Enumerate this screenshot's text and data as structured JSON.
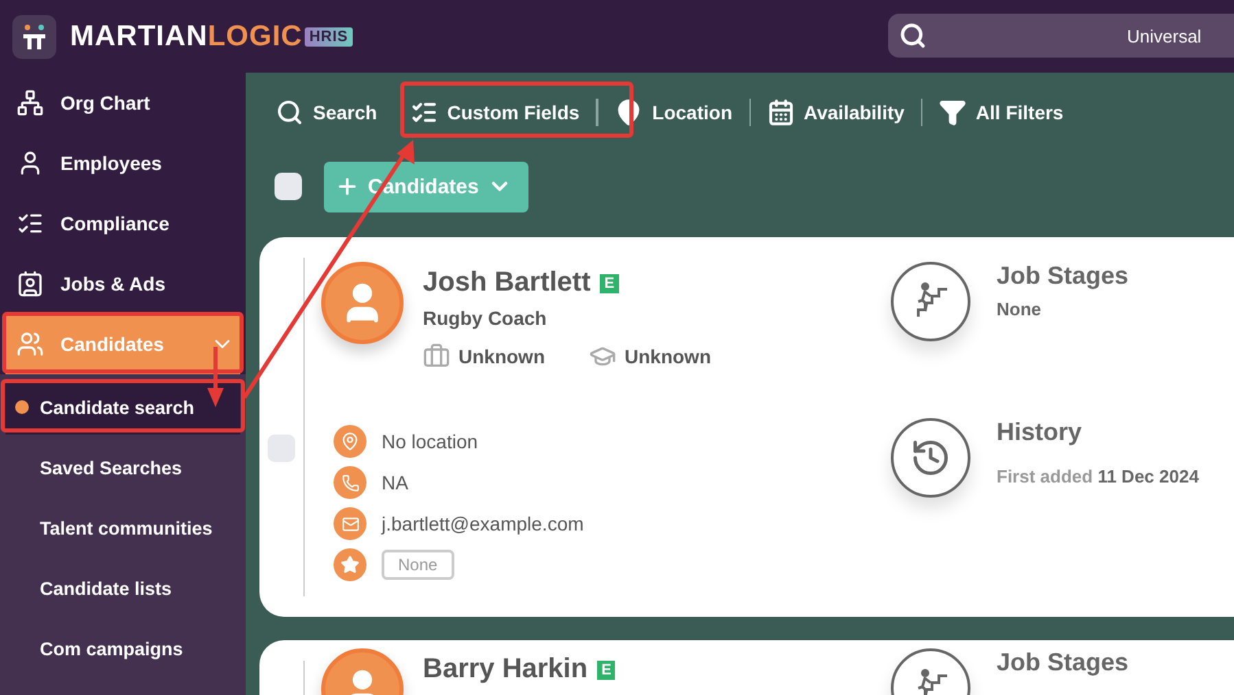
{
  "logo": {
    "main": "MARTIAN",
    "accent": "LOGIC",
    "badge": "HRIS"
  },
  "search": {
    "placeholder": "Universal"
  },
  "sidebar": {
    "items": [
      {
        "label": "Org Chart",
        "selected": false
      },
      {
        "label": "Employees",
        "selected": false
      },
      {
        "label": "Compliance",
        "selected": false
      },
      {
        "label": "Jobs & Ads",
        "selected": false
      },
      {
        "label": "Candidates",
        "selected": true,
        "expanded": true,
        "children": [
          {
            "label": "Candidate search",
            "selected": true
          },
          {
            "label": "Saved Searches",
            "selected": false
          },
          {
            "label": "Talent communities",
            "selected": false
          },
          {
            "label": "Candidate lists",
            "selected": false
          },
          {
            "label": "Com campaigns",
            "selected": false
          }
        ]
      }
    ]
  },
  "filters": [
    {
      "label": "Search"
    },
    {
      "label": "Custom Fields"
    },
    {
      "label": "Location"
    },
    {
      "label": "Availability"
    },
    {
      "label": "All Filters"
    }
  ],
  "select_all": {
    "checked": false
  },
  "add_button": {
    "label": "Candidates"
  },
  "candidates": [
    {
      "name": "Josh Bartlett",
      "badge": "E",
      "title": "Rugby Coach",
      "experience": "Unknown",
      "education": "Unknown",
      "location": "No location",
      "phone": "NA",
      "email": "j.bartlett@example.com",
      "tag": "None",
      "checked": false,
      "job_stages": {
        "title": "Job Stages",
        "value": "None"
      },
      "history": {
        "title": "History",
        "label": "First added",
        "date": "11 Dec 2024"
      }
    },
    {
      "name": "Barry Harkin",
      "badge": "E",
      "job_stages": {
        "title": "Job Stages"
      }
    }
  ]
}
